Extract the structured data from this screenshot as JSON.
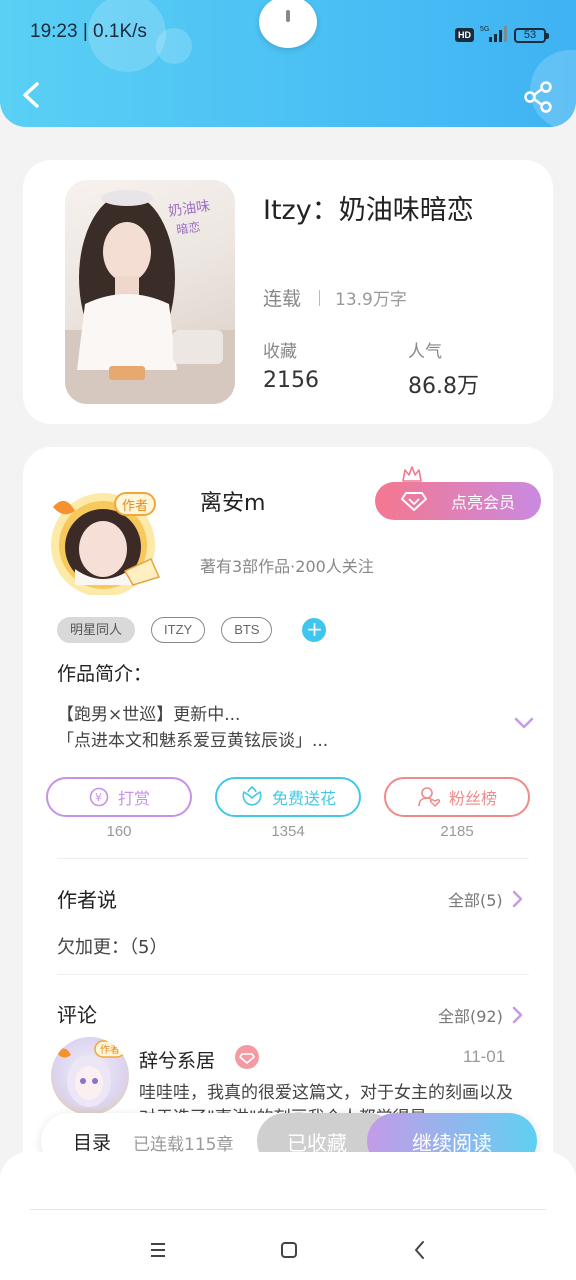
{
  "status_bar": {
    "time": "19:23 | 0.1K/s",
    "hd": "HD",
    "network": "5G",
    "battery": "53"
  },
  "header": {
    "back_icon": "back-arrow-icon",
    "share_icon": "share-icon",
    "gradient": [
      "#5ad0f5",
      "#3fb3f3"
    ]
  },
  "book": {
    "title": "Itzy：奶油味暗恋",
    "status": "连载",
    "word_count": "13.9万字",
    "collect_label": "收藏",
    "collect_value": "2156",
    "popularity_label": "人气",
    "popularity_value": "86.8万",
    "cover_icon": "book-cover-image"
  },
  "author": {
    "name": "离安m",
    "badge": "作者",
    "meta": "著有3部作品·200人关注",
    "vip_button": "点亮会员"
  },
  "tags": [
    "明星同人",
    "ITZY",
    "BTS"
  ],
  "intro": {
    "label": "作品简介：",
    "line1": "【跑男×世巡】更新中...",
    "line2": "「点进本文和魅系爱豆黄铉辰谈」..."
  },
  "actions": [
    {
      "label": "打赏",
      "count": "160",
      "color": "#c792e6",
      "icon": "yuan-coin-icon"
    },
    {
      "label": "免费送花",
      "count": "1354",
      "color": "#43c8e8",
      "icon": "flower-icon"
    },
    {
      "label": "粉丝榜",
      "count": "2185",
      "color": "#ef8a8a",
      "icon": "fan-user-icon"
    }
  ],
  "author_says": {
    "title": "作者说",
    "more": "全部(5)",
    "note": "欠加更：（5）"
  },
  "comments": {
    "title": "评论",
    "more": "全部(92)",
    "first": {
      "user": "辞兮系居",
      "badge": "作者",
      "date": "11-01",
      "text": "哇哇哇，我真的很爱这篇文，对于女主的刻画以及对于选了\"夷洪\"的刻画我个人都觉得是"
    }
  },
  "bottom_bar": {
    "toc": "目录",
    "chapters": "已连载115章",
    "collected": "已收藏",
    "read": "继续阅读"
  },
  "nav": {
    "menu_icon": "menu-icon",
    "home_icon": "home-square-icon",
    "back_icon": "nav-back-icon"
  }
}
